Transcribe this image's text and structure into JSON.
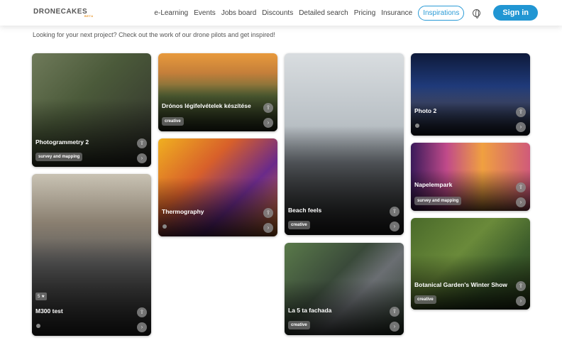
{
  "header": {
    "logo": "DRONECAKES",
    "logo_badge": "BETA",
    "nav": [
      "e-Learning",
      "Events",
      "Jobs board",
      "Discounts",
      "Detailed search",
      "Pricing",
      "Insurance"
    ],
    "active": "Inspirations",
    "signin": "Sign in",
    "globe_icon": "globe-icon"
  },
  "subtitle": "Looking for your next project? Check out the work of our drone pilots and get inspired!",
  "cards": [
    {
      "title": "Photogrammetry 2",
      "tag": "survey and mapping"
    },
    {
      "title": "M300 test",
      "rating": "5 ★"
    },
    {
      "title": "Drónos légifelvételek készítése",
      "tag": "creative"
    },
    {
      "title": "Thermography"
    },
    {
      "title": "Beach feels",
      "tag": "creative"
    },
    {
      "title": "La 5 ta fachada",
      "tag": "creative"
    },
    {
      "title": "Photo 2"
    },
    {
      "title": "Napelempark",
      "tag": "survey and mapping"
    },
    {
      "title": "Botanical Garden's Winter Show",
      "tag": "creative"
    }
  ]
}
